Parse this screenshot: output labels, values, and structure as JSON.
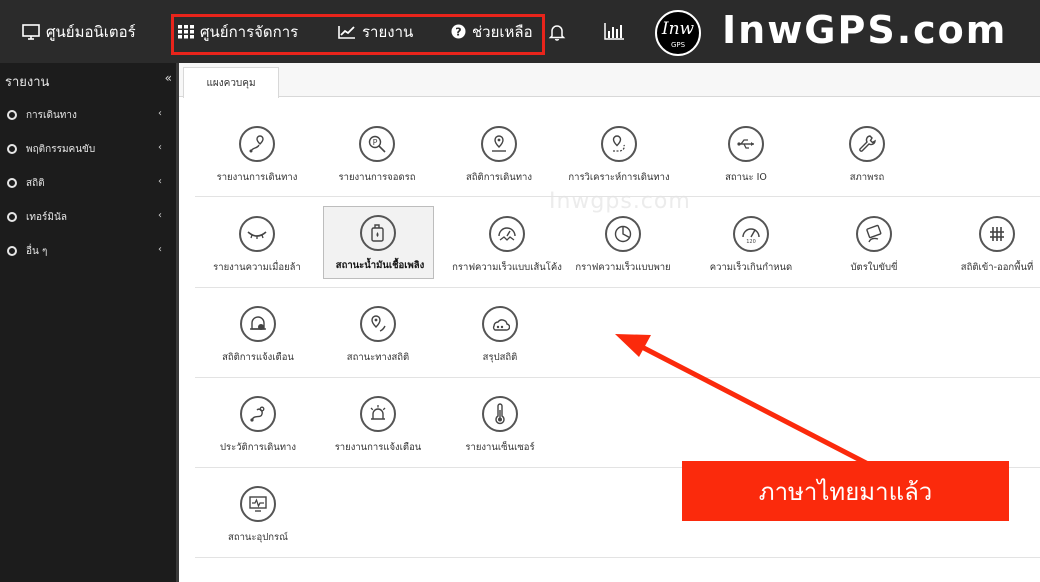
{
  "header": {
    "monitor_label": "ศูนย์มอนิเตอร์",
    "nav": [
      {
        "label": "ศูนย์การจัดการ",
        "icon": "grid-icon"
      },
      {
        "label": "รายงาน",
        "icon": "line-chart-icon"
      },
      {
        "label": "ช่วยเหลือ",
        "icon": "help-icon"
      }
    ],
    "logo_text": "Inw",
    "logo_sub": "GPS",
    "brand": "InwGPS.com"
  },
  "sidebar": {
    "title": "รายงาน",
    "collapse_glyph": "«",
    "items": [
      {
        "label": "การเดินทาง"
      },
      {
        "label": "พฤติกรรมคนขับ"
      },
      {
        "label": "สถิติ"
      },
      {
        "label": "เทอร์มินัล"
      },
      {
        "label": "อื่น ๆ"
      }
    ]
  },
  "tab": {
    "label": "แผงควบคุม"
  },
  "watermark": "Inwgps.com",
  "tiles": [
    {
      "label": "รายงานการเดินทาง",
      "icon": "route-pin-icon"
    },
    {
      "label": "รายงานการจอดรถ",
      "icon": "parking-icon"
    },
    {
      "label": "สถิติการเดินทาง",
      "icon": "trip-stats-icon"
    },
    {
      "label": "การวิเคราะห์การเดินทาง",
      "icon": "trip-analysis-icon"
    },
    {
      "label": "สถานะ IO",
      "icon": "usb-icon"
    },
    {
      "label": "สภาพรถ",
      "icon": "wrench-icon"
    },
    {
      "label": "รายงานความเมื่อยล้า",
      "icon": "eye-icon"
    },
    {
      "label": "สถานะน้ำมันเชื้อเพลิง",
      "icon": "fuel-icon",
      "selected": true
    },
    {
      "label": "กราฟความเร็วแบบเส้นโค้ง",
      "icon": "speedometer-icon"
    },
    {
      "label": "กราฟความเร็วแบบพาย",
      "icon": "pie-icon"
    },
    {
      "label": "ความเร็วเกินกำหนด",
      "icon": "overspeed-icon"
    },
    {
      "label": "บัตรใบขับขี่",
      "icon": "license-card-icon"
    },
    {
      "label": "สถิติเข้า-ออกพื้นที่",
      "icon": "fence-icon"
    },
    {
      "label": "สถิติการแจ้งเตือน",
      "icon": "alert-stats-icon"
    },
    {
      "label": "สถานะทางสถิติ",
      "icon": "stat-status-icon"
    },
    {
      "label": "สรุปสถิติ",
      "icon": "summary-icon"
    },
    {
      "label": "ประวัติการเดินทาง",
      "icon": "history-icon"
    },
    {
      "label": "รายงานการแจ้งเตือน",
      "icon": "alarm-icon"
    },
    {
      "label": "รายงานเซ็นเซอร์",
      "icon": "thermometer-icon"
    },
    {
      "label": "สถานะอุปกรณ์",
      "icon": "device-icon"
    }
  ],
  "callout": "ภาษาไทยมาแล้ว",
  "colors": {
    "topbar": "#2b2b2b",
    "sidebar": "#1c1c1c",
    "highlight": "#e8241b",
    "callout": "#fb2a0c"
  }
}
